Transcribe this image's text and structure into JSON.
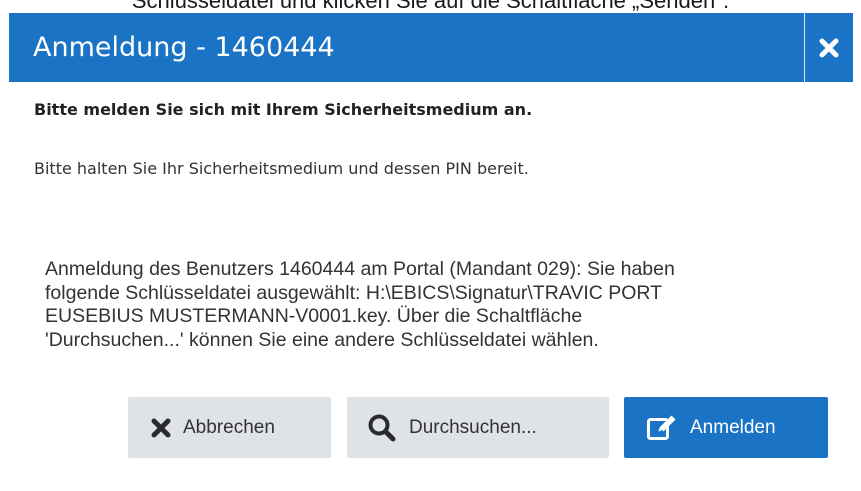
{
  "top_fragment": "Schlüsseldatei und klicken Sie auf die Schaltfläche „Senden\".",
  "dialog": {
    "title": "Anmeldung - 1460444",
    "close_icon": "close-icon",
    "heading": "Bitte melden Sie sich mit Ihrem Sicherheitsmedium an.",
    "subtext": "Bitte halten Sie Ihr Sicherheitsmedium und dessen PIN bereit.",
    "info_lines": [
      "Anmeldung des Benutzers 1460444 am Portal (Mandant 029): Sie haben",
      "folgende Schlüsseldatei ausgewählt: H:\\EBICS\\Signatur\\TRAVIC PORT",
      "EUSEBIUS MUSTERMANN-V0001.key. Über die Schaltfläche",
      "'Durchsuchen...' können Sie eine andere Schlüsseldatei wählen."
    ]
  },
  "buttons": {
    "cancel": {
      "label": "Abbrechen",
      "icon": "x-icon"
    },
    "browse": {
      "label": "Durchsuchen...",
      "icon": "search-icon"
    },
    "login": {
      "label": "Anmelden",
      "icon": "edit-icon"
    }
  },
  "colors": {
    "accent": "#1a73c4",
    "button_gray": "#dfe2e6"
  }
}
